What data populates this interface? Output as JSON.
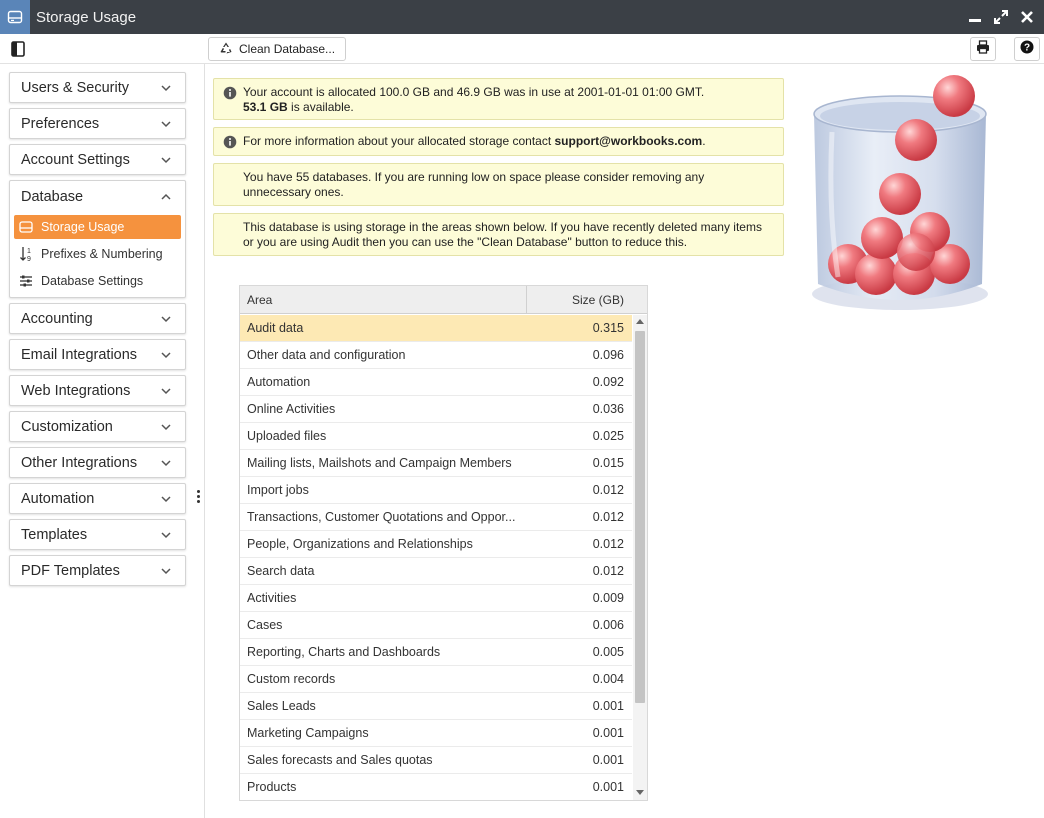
{
  "window": {
    "title": "Storage Usage",
    "icon": "storage-icon",
    "controls": [
      "minimize-icon",
      "expand-icon",
      "close-icon"
    ]
  },
  "toolbar": {
    "clean_label": "Clean Database...",
    "print_icon": "print-icon",
    "help_icon": "help-icon"
  },
  "sidebar": {
    "sections": [
      {
        "label": "Users & Security"
      },
      {
        "label": "Preferences"
      },
      {
        "label": "Account Settings"
      }
    ],
    "database": {
      "label": "Database",
      "items": [
        {
          "label": "Storage Usage",
          "icon": "storage-icon",
          "active": true
        },
        {
          "label": "Prefixes & Numbering",
          "icon": "numbering-icon"
        },
        {
          "label": "Database Settings",
          "icon": "sliders-icon"
        }
      ]
    },
    "sections_after": [
      {
        "label": "Accounting"
      },
      {
        "label": "Email Integrations"
      },
      {
        "label": "Web Integrations"
      },
      {
        "label": "Customization"
      },
      {
        "label": "Other Integrations"
      },
      {
        "label": "Automation"
      },
      {
        "label": "Templates"
      },
      {
        "label": "PDF Templates"
      }
    ]
  },
  "notices": {
    "allocation_line1": "Your account is allocated 100.0 GB and 46.9 GB was in use at 2001-01-01 01:00 GMT.",
    "allocation_available_value": "53.1 GB",
    "allocation_available_suffix": " is available.",
    "contact_prefix": "For more information about your allocated storage contact ",
    "contact_email": "support@workbooks.com",
    "contact_suffix": ".",
    "databases": "You have 55 databases. If you are running low on space please consider removing any unnecessary ones.",
    "storage_info": "This database is using storage in the areas shown below. If you have recently deleted many items or you are using Audit then you can use the \"Clean Database\" button to reduce this."
  },
  "grid": {
    "col_area": "Area",
    "col_size": "Size (GB)",
    "rows": [
      {
        "area": "Audit data",
        "size": "0.315"
      },
      {
        "area": "Other data and configuration",
        "size": "0.096"
      },
      {
        "area": "Automation",
        "size": "0.092"
      },
      {
        "area": "Online Activities",
        "size": "0.036"
      },
      {
        "area": "Uploaded files",
        "size": "0.025"
      },
      {
        "area": "Mailing lists, Mailshots and Campaign Members",
        "size": "0.015"
      },
      {
        "area": "Import jobs",
        "size": "0.012"
      },
      {
        "area": "Transactions, Customer Quotations and Oppor...",
        "size": "0.012"
      },
      {
        "area": "People, Organizations and Relationships",
        "size": "0.012"
      },
      {
        "area": "Search data",
        "size": "0.012"
      },
      {
        "area": "Activities",
        "size": "0.009"
      },
      {
        "area": "Cases",
        "size": "0.006"
      },
      {
        "area": "Reporting, Charts and Dashboards",
        "size": "0.005"
      },
      {
        "area": "Custom records",
        "size": "0.004"
      },
      {
        "area": "Sales Leads",
        "size": "0.001"
      },
      {
        "area": "Marketing Campaigns",
        "size": "0.001"
      },
      {
        "area": "Sales forecasts and Sales quotas",
        "size": "0.001"
      },
      {
        "area": "Products",
        "size": "0.001"
      }
    ]
  },
  "colors": {
    "titlebar": "#3b4046",
    "accent": "#f5923e",
    "notice_bg": "#fdfcd8",
    "selected_row": "#fde9b4"
  }
}
